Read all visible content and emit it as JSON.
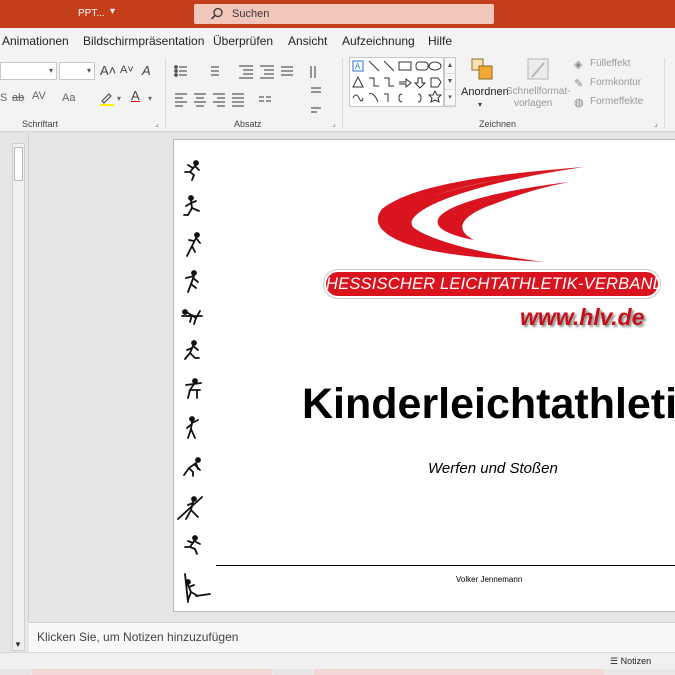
{
  "titlebar": {
    "app_name": "PPT...",
    "dropdown_glyph": "▾",
    "search_placeholder": "Suchen",
    "background_color": "#c43e1c"
  },
  "ribbon_tabs": [
    {
      "label": "Animationen"
    },
    {
      "label": "Bildschirmpräsentation"
    },
    {
      "label": "Überprüfen"
    },
    {
      "label": "Ansicht"
    },
    {
      "label": "Aufzeichnung"
    },
    {
      "label": "Hilfe"
    }
  ],
  "ribbon": {
    "font_group": {
      "label": "Schriftart",
      "grow_font": "A˄",
      "shrink_font": "A˅",
      "clear_format": "A",
      "strikethrough": "ab",
      "char_spacing": "AV",
      "change_case": "Aa",
      "highlight_icon": "highlighter-icon",
      "font_color": "A"
    },
    "paragraph_group": {
      "label": "Absatz"
    },
    "drawing_group": {
      "label": "Zeichnen",
      "arrange_label": "Anordnen",
      "quick_styles_label": "Schnellformat-vorlagen",
      "quick_styles_line1": "Schnellformat-",
      "quick_styles_line2": "vorlagen",
      "fill_label": "Fülleffekt",
      "outline_label": "Formkontur",
      "effects_label": "Formeffekte"
    }
  },
  "slide": {
    "org_banner": "HESSISCHER LEICHTATHLETIK-VERBAND",
    "website": "www.hlv.de",
    "title": "Kinderleichtathletik",
    "subtitle": "Werfen und Stoßen",
    "author": "Volker Jennemann",
    "brand_red": "#d9141f",
    "athlete_icons": [
      "sprinter-icon",
      "long-jumper-icon",
      "triple-jumper-icon",
      "runner-icon",
      "high-jumper-icon",
      "walker-icon",
      "hurdler-icon",
      "shot-putter-icon",
      "starter-icon",
      "javelin-icon",
      "crouch-runner-icon",
      "pole-vaulter-icon"
    ]
  },
  "notes": {
    "placeholder": "Klicken Sie, um Notizen hinzuzufügen"
  },
  "statusbar": {
    "notes_button": "Notizen"
  }
}
